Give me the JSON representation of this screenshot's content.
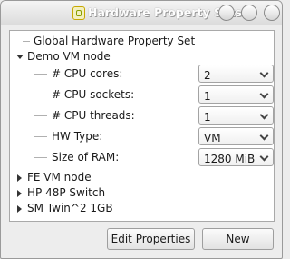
{
  "window": {
    "title": "Hardware Property Sets"
  },
  "tree": {
    "global": "Global Hardware Property Set",
    "demo_node": "Demo VM node",
    "properties": [
      {
        "label": "# CPU cores:",
        "value": "2"
      },
      {
        "label": "# CPU sockets:",
        "value": "1"
      },
      {
        "label": "# CPU threads:",
        "value": "1"
      },
      {
        "label": "HW Type:",
        "value": "VM"
      },
      {
        "label": "Size of RAM:",
        "value": "1280 MiB"
      }
    ],
    "collapsed": [
      "FE VM node",
      "HP 48P Switch",
      "SM Twin^2 1GB"
    ]
  },
  "buttons": {
    "edit": "Edit Properties",
    "new": "New"
  }
}
